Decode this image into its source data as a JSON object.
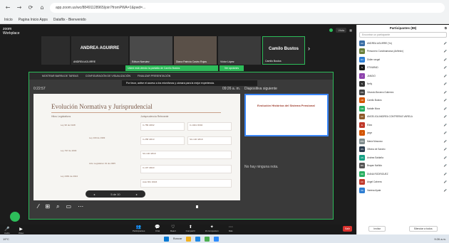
{
  "browser": {
    "nav": [
      "←",
      "→",
      "⟳",
      "⌂"
    ],
    "url": "app.zoom.us/wc/88491128965/join?fromPWA=1&pwd=...",
    "bookmarks": [
      "Inicio",
      "Pagina Inicio Apps",
      "Dataflix - Bienvenido"
    ]
  },
  "zoom": {
    "logo_top": "zoom",
    "logo_bottom": "Workplace",
    "status_right": "Vista",
    "thumbs": [
      {
        "big": "",
        "name": ""
      },
      {
        "big": "ANDREA AGUIRRE",
        "name": "ANDREA AGUIRRE"
      },
      {
        "big": "",
        "name": "Edison Narváez"
      },
      {
        "big": "",
        "name": "Diana Patricia Castro Rojas"
      },
      {
        "big": "",
        "name": "Víctor López"
      },
      {
        "big": "Camilo Bustos",
        "name": "Camilo Bustos"
      }
    ],
    "next_arrow": "›",
    "banner": "Usted está viendo la pantalla de Camilo Bustos",
    "view_options": "Ver opciones",
    "share_bar": [
      "MOSTRAR BARRA DE TAREAS",
      "CONFIGURACIÓN DE VISUALIZACIÓN",
      "FINALIZAR PRESENTACIÓN"
    ],
    "notice": "Por favor, active el acceso a los micrófonos y cámara para la mejor experiencia.",
    "timer": "0:22:57",
    "clock": "09:26 a. m.",
    "slide": {
      "title": "Evolución Normativa y Jurisprudencial",
      "col1_head": "Hitos Legislativos",
      "col2_head": "Jurisprudencia Relevante",
      "items": [
        "Ley 90 de 1948",
        "Ley 100 de 1993",
        "Ley 797 de 2003",
        "Acto Legislativo 01 de 2005",
        "Ley 2381 de 2024"
      ],
      "boxes": [
        "C-789 /2002",
        "C-1024 /2004",
        "C-258 /2013",
        "SU-140 /2019",
        "SU-140 /2019",
        "C-197 /2023",
        "Auto 841 /2024"
      ]
    },
    "next_slide_label": "Diapositiva siguiente",
    "next_slide_title": "Evolución Histórica del Sistema Pensional",
    "notes": "No hay ninguna nota.",
    "tools": [
      "⁄",
      "⊞",
      "⌕",
      "▭",
      "⋯"
    ],
    "slide_nav": [
      "◂",
      "5 de 10",
      "▸"
    ],
    "toolbar_left": [
      {
        "icon": "🎤",
        "label": "Audio"
      },
      {
        "icon": "▶",
        "label": "Video"
      }
    ],
    "toolbar_center": [
      {
        "icon": "👥",
        "label": "Participantes"
      },
      {
        "icon": "💬",
        "label": "Chat"
      },
      {
        "icon": "♡",
        "label": "React"
      },
      {
        "icon": "⬆",
        "label": "Compartir"
      },
      {
        "icon": "✦",
        "label": "IA Companion"
      },
      {
        "icon": "⋯",
        "label": "Más"
      }
    ],
    "leave": "Salir"
  },
  "participants": {
    "title": "Participantes (88)",
    "search_placeholder": "Encontrar un participante",
    "people": [
      {
        "initials": "AA",
        "name": "ANDREA AGUIRRE (Yo)",
        "color": "#3a6ea5"
      },
      {
        "initials": "DC",
        "name": "Personero Cundinamarca (Anfitrión)",
        "color": "#6a7f3a"
      },
      {
        "initials": "DV",
        "name": "Didier rangel",
        "color": "#2d7dd2"
      },
      {
        "initials": "S",
        "name": "STIVARAD",
        "color": "#1a1a1a"
      },
      {
        "initials": "J",
        "name": "JANGIO",
        "color": "#8e44ad"
      },
      {
        "initials": "N",
        "name": "Nelly",
        "color": "#333"
      },
      {
        "initials": "OG",
        "name": "Orlando Becerra Gutierrez",
        "color": "#444"
      },
      {
        "initials": "CB",
        "name": "Camilo Bustos",
        "color": "#d35400"
      },
      {
        "initials": "NM",
        "name": "Natalie Mora",
        "color": "#27ae60"
      },
      {
        "initials": "AC",
        "name": "ANGELICA ANDREA CONTRERAS VARELA",
        "color": "#8e5a2a"
      },
      {
        "initials": "E",
        "name": "Eliza",
        "color": "#c0392b"
      },
      {
        "initials": "J",
        "name": "jorge",
        "color": "#d35400"
      },
      {
        "initials": "MM",
        "name": "María Moscoso",
        "color": "#7f8c8d"
      },
      {
        "initials": "OS",
        "name": "Oficina de Sandro",
        "color": "#2c3e50"
      },
      {
        "initials": "AS",
        "name": "Andrea Saldaña",
        "color": "#16a085"
      },
      {
        "initials": "BN",
        "name": "Brayan Nañido",
        "color": "#555"
      },
      {
        "initials": "DR",
        "name": "DIANA RODRIGUEZ",
        "color": "#27ae60"
      },
      {
        "initials": "AC",
        "name": "Angel Cabrera",
        "color": "#c0392b"
      },
      {
        "initials": "VA",
        "name": "Vanesa Ayala",
        "color": "#2d7dd2"
      }
    ],
    "invite": "Invitar",
    "mute_all": "Silenciar a todos"
  },
  "taskbar": {
    "weather": "19°C",
    "search": "Buscar",
    "clock": "9:26 a.m."
  },
  "colors": {
    "zoom_green": "#2dbd5a",
    "leave_red": "#d9302c",
    "slide_title": "#7a5a4a"
  }
}
